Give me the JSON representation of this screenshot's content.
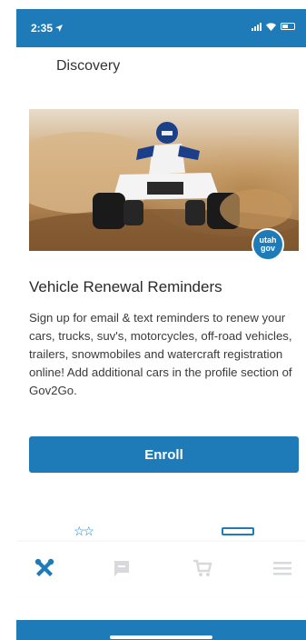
{
  "status_bar": {
    "time": "2:35",
    "icons": [
      "location-arrow-icon",
      "signal-icon",
      "wifi-icon",
      "battery-icon"
    ]
  },
  "header": {
    "title": "Discovery"
  },
  "hero": {
    "image": "atv-rider-photo",
    "badge": {
      "line1": "utah",
      "line2": "gov"
    }
  },
  "card": {
    "title": "Vehicle Renewal Reminders",
    "description": "Sign up for email & text reminders to renew your cars, trucks, suv's, motorcycles, off-road vehicles, trailers, snowmobiles and watercraft registration online! Add additional cars in the profile section of Gov2Go.",
    "enroll_label": "Enroll"
  },
  "below_icons": [
    "stars-outline-icon",
    "card-outline-icon"
  ],
  "tab_bar": {
    "items": [
      {
        "icon": "tools-icon",
        "active": true
      },
      {
        "icon": "chat-icon",
        "active": false
      },
      {
        "icon": "cart-icon",
        "active": false
      },
      {
        "icon": "menu-icon",
        "active": false
      }
    ]
  },
  "colors": {
    "primary": "#1e7bb8",
    "inactive_icon": "#d7d9dc",
    "text": "#2a2a2a"
  }
}
